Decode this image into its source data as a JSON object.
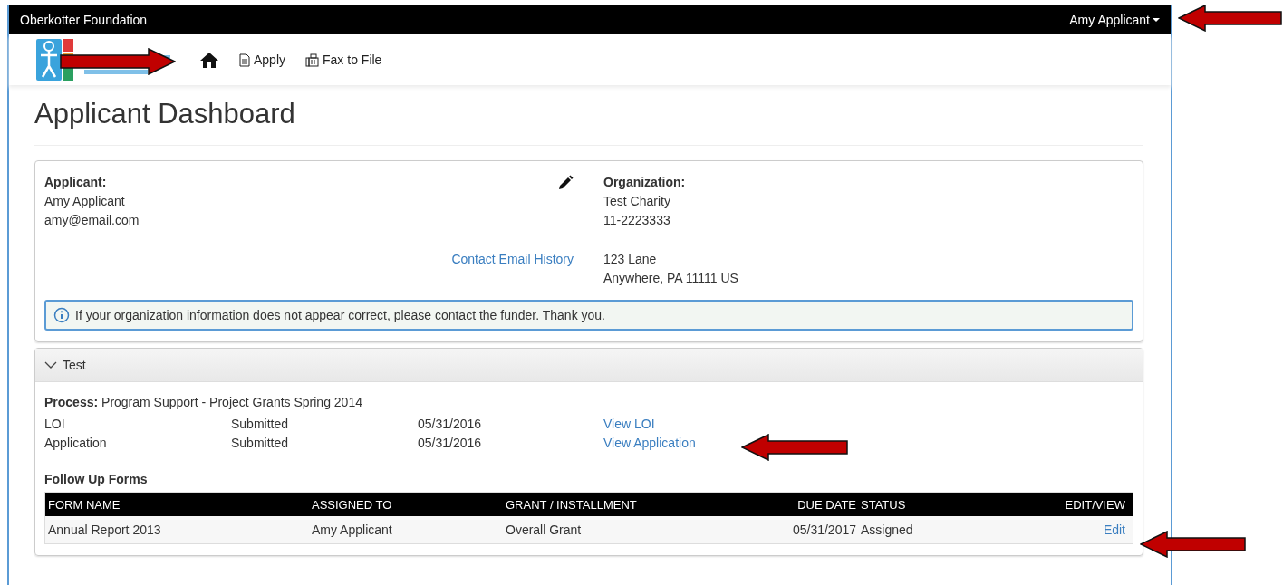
{
  "top_bar": {
    "brand": "Oberkotter Foundation",
    "user_menu": "Amy Applicant"
  },
  "nav": {
    "items": [
      {
        "kind": "home"
      },
      {
        "kind": "doc",
        "label": "Apply"
      },
      {
        "kind": "fax",
        "label": "Fax to File"
      }
    ]
  },
  "page_title": "Applicant Dashboard",
  "applicant": {
    "heading": "Applicant:",
    "name": "Amy Applicant",
    "email": "amy@email.com",
    "link": "Contact Email History"
  },
  "organization": {
    "heading": "Organization:",
    "name": "Test Charity",
    "ein": "11-2223333",
    "address": [
      "123 Lane",
      "Anywhere, PA 11111 US"
    ]
  },
  "notice": "If your organization information does not appear correct, please contact the funder. Thank you.",
  "section": {
    "title": "Test",
    "expanded": true,
    "process_label": "Process:",
    "process": "Program Support - Project Grants Spring 2014",
    "steps": [
      {
        "name": "LOI",
        "status": "Submitted",
        "date": "05/31/2016",
        "link": "View LOI"
      },
      {
        "name": "Application",
        "status": "Submitted",
        "date": "05/31/2016",
        "link": "View Application"
      }
    ],
    "follow_up_title": "Follow Up Forms",
    "table": {
      "columns": [
        "FORM NAME",
        "ASSIGNED TO",
        "GRANT / INSTALLMENT",
        "DUE DATE",
        "STATUS",
        "EDIT/VIEW"
      ],
      "rows": [
        [
          "Annual Report 2013",
          "Amy Applicant",
          "Overall Grant",
          "05/31/2017",
          "Assigned",
          "Edit"
        ]
      ]
    }
  }
}
